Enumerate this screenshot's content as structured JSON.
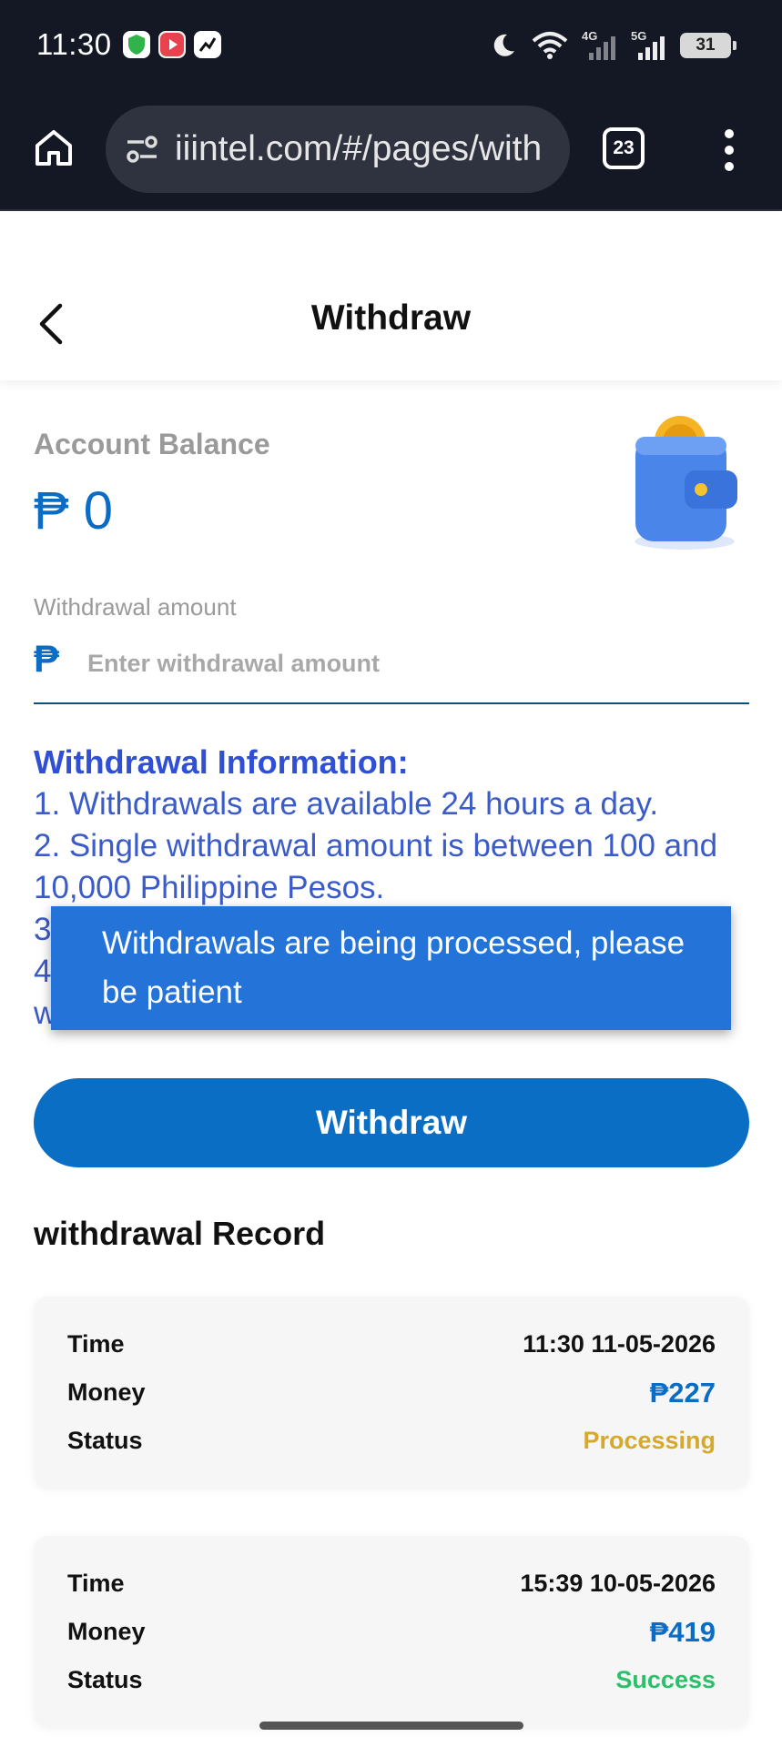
{
  "status_bar": {
    "time": "11:30",
    "battery": "31",
    "net1_label": "4G",
    "net2_label": "5G"
  },
  "browser": {
    "url": "iiintel.com/#/pages/with",
    "tab_count": "23"
  },
  "header": {
    "title": "Withdraw"
  },
  "balance": {
    "label": "Account Balance",
    "value": "₱ 0"
  },
  "amount_input": {
    "label": "Withdrawal amount",
    "currency_symbol": "₱",
    "placeholder": "Enter withdrawal amount"
  },
  "info": {
    "title": "Withdrawal Information:",
    "lines": [
      "1. Withdrawals are available 24 hours a day.",
      "2. Single withdrawal amount is between 100 and 10,000 Philippine Pesos.",
      "3",
      "4",
      "w"
    ]
  },
  "toast": {
    "message": "Withdrawals are being processed, please be patient"
  },
  "withdraw_button": {
    "label": "Withdraw"
  },
  "records": {
    "title": "withdrawal Record",
    "field_labels": {
      "time": "Time",
      "money": "Money",
      "status": "Status"
    },
    "items": [
      {
        "time": "11:30 11-05-2026",
        "money": "₱227",
        "status": "Processing",
        "status_color": "#d6a92b"
      },
      {
        "time": "15:39 10-05-2026",
        "money": "₱419",
        "status": "Success",
        "status_color": "#2cc06a"
      }
    ]
  },
  "colors": {
    "accent": "#0a6ec4",
    "info_text": "#3b5bc9",
    "toast_bg": "#2473d8"
  }
}
